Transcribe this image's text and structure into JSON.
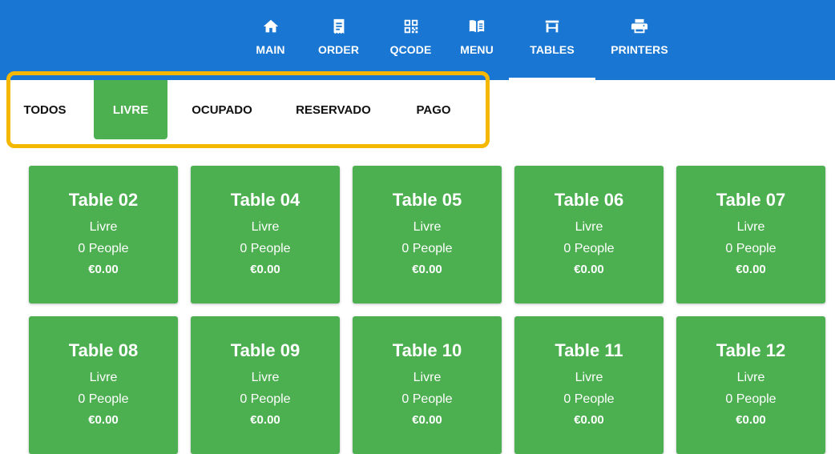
{
  "colors": {
    "topbar": "#1976d2",
    "accent_green": "#4caf50",
    "highlight_border": "#f5b800"
  },
  "nav": {
    "items": [
      {
        "label": "MAIN",
        "icon": "home-icon",
        "active": false
      },
      {
        "label": "ORDER",
        "icon": "receipt-icon",
        "active": false
      },
      {
        "label": "QCODE",
        "icon": "qr-code-icon",
        "active": false
      },
      {
        "label": "MENU",
        "icon": "menu-book-icon",
        "active": false
      },
      {
        "label": "TABLES",
        "icon": "table-icon",
        "active": true
      },
      {
        "label": "PRINTERS",
        "icon": "printer-icon",
        "active": false
      }
    ]
  },
  "filters": {
    "tabs": [
      {
        "label": "TODOS",
        "active": false
      },
      {
        "label": "LIVRE",
        "active": true
      },
      {
        "label": "OCUPADO",
        "active": false
      },
      {
        "label": "RESERVADO",
        "active": false
      },
      {
        "label": "PAGO",
        "active": false
      }
    ]
  },
  "tables": [
    {
      "name": "Table 02",
      "status": "Livre",
      "people": "0 People",
      "amount": "€0.00"
    },
    {
      "name": "Table 04",
      "status": "Livre",
      "people": "0 People",
      "amount": "€0.00"
    },
    {
      "name": "Table 05",
      "status": "Livre",
      "people": "0 People",
      "amount": "€0.00"
    },
    {
      "name": "Table 06",
      "status": "Livre",
      "people": "0 People",
      "amount": "€0.00"
    },
    {
      "name": "Table 07",
      "status": "Livre",
      "people": "0 People",
      "amount": "€0.00"
    },
    {
      "name": "Table 08",
      "status": "Livre",
      "people": "0 People",
      "amount": "€0.00"
    },
    {
      "name": "Table 09",
      "status": "Livre",
      "people": "0 People",
      "amount": "€0.00"
    },
    {
      "name": "Table 10",
      "status": "Livre",
      "people": "0 People",
      "amount": "€0.00"
    },
    {
      "name": "Table 11",
      "status": "Livre",
      "people": "0 People",
      "amount": "€0.00"
    },
    {
      "name": "Table 12",
      "status": "Livre",
      "people": "0 People",
      "amount": "€0.00"
    }
  ]
}
